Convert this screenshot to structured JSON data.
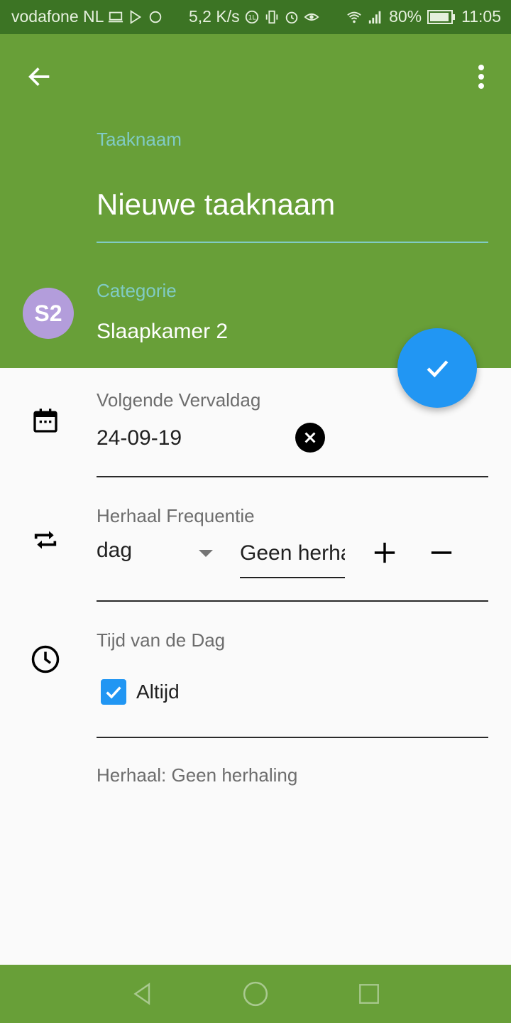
{
  "status_bar": {
    "carrier": "vodafone NL",
    "speed": "5,2 K/s",
    "battery": "80%",
    "time": "11:05"
  },
  "header": {
    "task_name_label": "Taaknaam",
    "task_name_value": "Nieuwe taaknaam",
    "category_label": "Categorie",
    "category_value": "Slaapkamer 2",
    "category_initials": "S2"
  },
  "due_date": {
    "label": "Volgende Vervaldag",
    "value": "24-09-19"
  },
  "frequency": {
    "label": "Herhaal Frequentie",
    "unit": "dag",
    "input_value": "Geen herhaling"
  },
  "time_of_day": {
    "label": "Tijd van de Dag",
    "checkbox_label": "Altijd",
    "checked": true
  },
  "summary": "Herhaal: Geen herhaling",
  "colors": {
    "primary": "#689f38",
    "primary_dark": "#3c7424",
    "accent": "#2196f3",
    "label_teal": "#80cbc4",
    "avatar": "#b39ddb"
  },
  "icons": [
    "back-arrow-icon",
    "more-vert-icon",
    "calendar-icon",
    "repeat-icon",
    "clock-icon",
    "check-icon",
    "close-icon",
    "plus-icon",
    "minus-icon"
  ]
}
